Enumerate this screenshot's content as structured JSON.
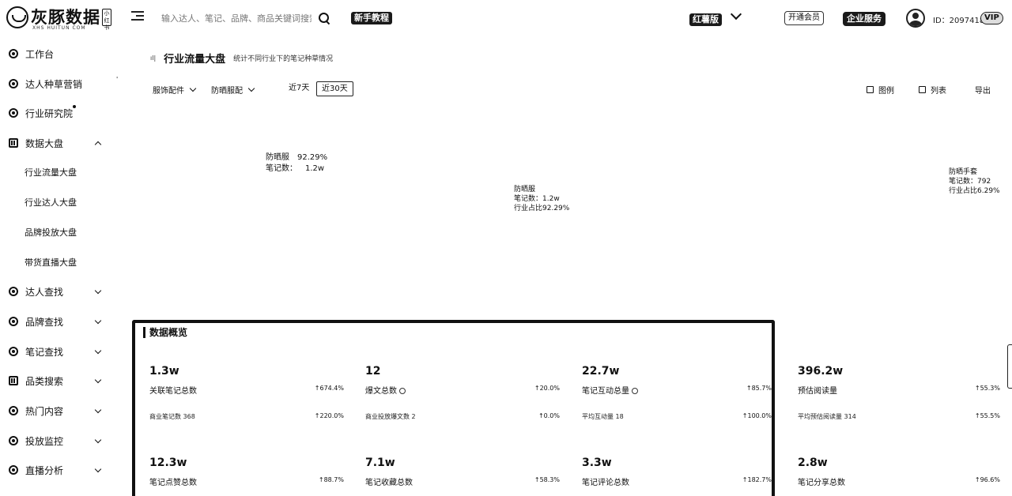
{
  "header": {
    "logo_text": "灰豚数据",
    "logo_sub": "XHS HUITUN COM",
    "logo_badge": "小红书",
    "search_placeholder": "输入达人、笔记、品牌、商品关键词搜索",
    "link_label": "新手教程",
    "platform_label": "红薯版",
    "action1_label": "开通会员",
    "action2_label": "企业服务",
    "user_id": "ID：2097418",
    "vip_label": "VIP"
  },
  "sidebar": {
    "items": [
      {
        "label": "工作台"
      },
      {
        "label": "达人种草营销"
      },
      {
        "label": "行业研究院"
      },
      {
        "label": "数据大盘"
      },
      {
        "label": "行业流量大盘"
      },
      {
        "label": "行业达人大盘"
      },
      {
        "label": "品牌投放大盘"
      },
      {
        "label": "带货直播大盘"
      },
      {
        "label": "达人查找"
      },
      {
        "label": "品牌查找"
      },
      {
        "label": "笔记查找"
      },
      {
        "label": "品类搜索"
      },
      {
        "label": "热门内容"
      },
      {
        "label": "投放监控"
      },
      {
        "label": "直播分析"
      }
    ]
  },
  "page": {
    "icon_text": "ıl|",
    "title": "行业流量大盘",
    "subtitle": "统计不同行业下的笔记种草情况",
    "filters": [
      "服饰配件",
      "防晒服配"
    ],
    "time_tabs": [
      "近7天",
      "近30天"
    ],
    "view_buttons": [
      "图例",
      "列表",
      "导出"
    ]
  },
  "treemap": {
    "main": {
      "name": "防晒服",
      "share": "92.29%",
      "notes_label": "笔记数：",
      "notes": "1.2w"
    },
    "center": {
      "name": "防晒服",
      "notes": "笔记数：1.2w",
      "share": "行业占比92.29%"
    },
    "right": {
      "name": "防晒手套",
      "notes": "笔记数：792",
      "share": "行业占比6.29%"
    }
  },
  "overview": {
    "title": "数据概览",
    "metrics": [
      {
        "value": "1.3w",
        "label": "关联笔记总数",
        "change": "↑674.4%",
        "sub": "商业笔记数 368",
        "sub_change": "↑220.0%"
      },
      {
        "value": "12",
        "label": "爆文总数",
        "change": "↑20.0%",
        "sub": "商业投放爆文数 2",
        "sub_change": "↑0.0%"
      },
      {
        "value": "22.7w",
        "label": "笔记互动总量",
        "change": "↑85.7%",
        "sub": "平均互动量 18",
        "sub_change": "↑100.0%"
      },
      {
        "value": "396.2w",
        "label": "预估阅读量",
        "change": "↑55.3%",
        "sub": "平均预估阅读量 314",
        "sub_change": "↑55.5%"
      },
      {
        "value": "12.3w",
        "label": "笔记点赞总数",
        "change": "↑88.7%"
      },
      {
        "value": "7.1w",
        "label": "笔记收藏总数",
        "change": "↑58.3%"
      },
      {
        "value": "3.3w",
        "label": "笔记评论总数",
        "change": "↑182.7%"
      },
      {
        "value": "2.8w",
        "label": "笔记分享总数",
        "change": "↑96.6%"
      }
    ]
  }
}
